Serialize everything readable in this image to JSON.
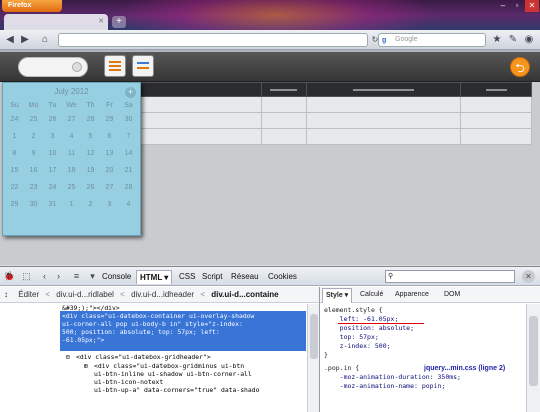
{
  "browser": {
    "menu_label": "Firefox",
    "new_tab": "+",
    "url_placeholder": "",
    "search_placeholder": "Google",
    "win_controls": [
      "–",
      "▫",
      "✕"
    ]
  },
  "app": {
    "date_placeholder": "",
    "back_glyph": "⮌"
  },
  "calendar": {
    "month_label": "July 2012",
    "add": "+",
    "weekdays": [
      "Su",
      "Mo",
      "Tu",
      "We",
      "Th",
      "Fr",
      "Sa"
    ],
    "days": [
      "24",
      "25",
      "26",
      "27",
      "28",
      "29",
      "30",
      "1",
      "2",
      "3",
      "4",
      "5",
      "6",
      "7",
      "8",
      "9",
      "10",
      "11",
      "12",
      "13",
      "14",
      "15",
      "16",
      "17",
      "18",
      "19",
      "20",
      "21",
      "22",
      "23",
      "24",
      "25",
      "26",
      "27",
      "28",
      "29",
      "30",
      "31",
      "1",
      "2",
      "3",
      "4"
    ]
  },
  "firebug": {
    "tabs": [
      "Console",
      "HTML",
      "CSS",
      "Script",
      "Réseau",
      "Cookies"
    ],
    "edit_label": "Éditer",
    "breadcrumbs": [
      "div.ui-d...ridlabel",
      "div.ui-d...idheader",
      "div.ui-d...containe"
    ],
    "side_tabs": [
      "Style",
      "Calculé",
      "Apparence",
      "DOM"
    ],
    "html_lines": [
      "&#39;);\"></div>",
      "<div class=\"ui-datebox-container ui-overlay-shadow",
      "ui-corner-all pop ui-body-b in\" style=\"z-index:",
      "500; position: absolute; top: 57px; left:",
      "-61.05px;\">",
      "<div class=\"ui-datebox-gridheader\">",
      "<div class=\"ui-datebox-gridminus ui-btn",
      "ui-btn-inline ui-shadow ui-btn-corner-all",
      "ui-btn-icon-notext",
      "ui-btn-up-a\" data-corners=\"true\" data-shado"
    ],
    "style_lines": [
      "element.style {",
      "    left: -61.05px;",
      "    position: absolute;",
      "    top: 57px;",
      "    z-index: 500;",
      "}",
      ".pop.in {",
      "    -moz-animation-duration: 350ms;",
      "    -moz-animation-name: popin;"
    ],
    "source_link": "jquery...min.css (ligne 2)"
  }
}
